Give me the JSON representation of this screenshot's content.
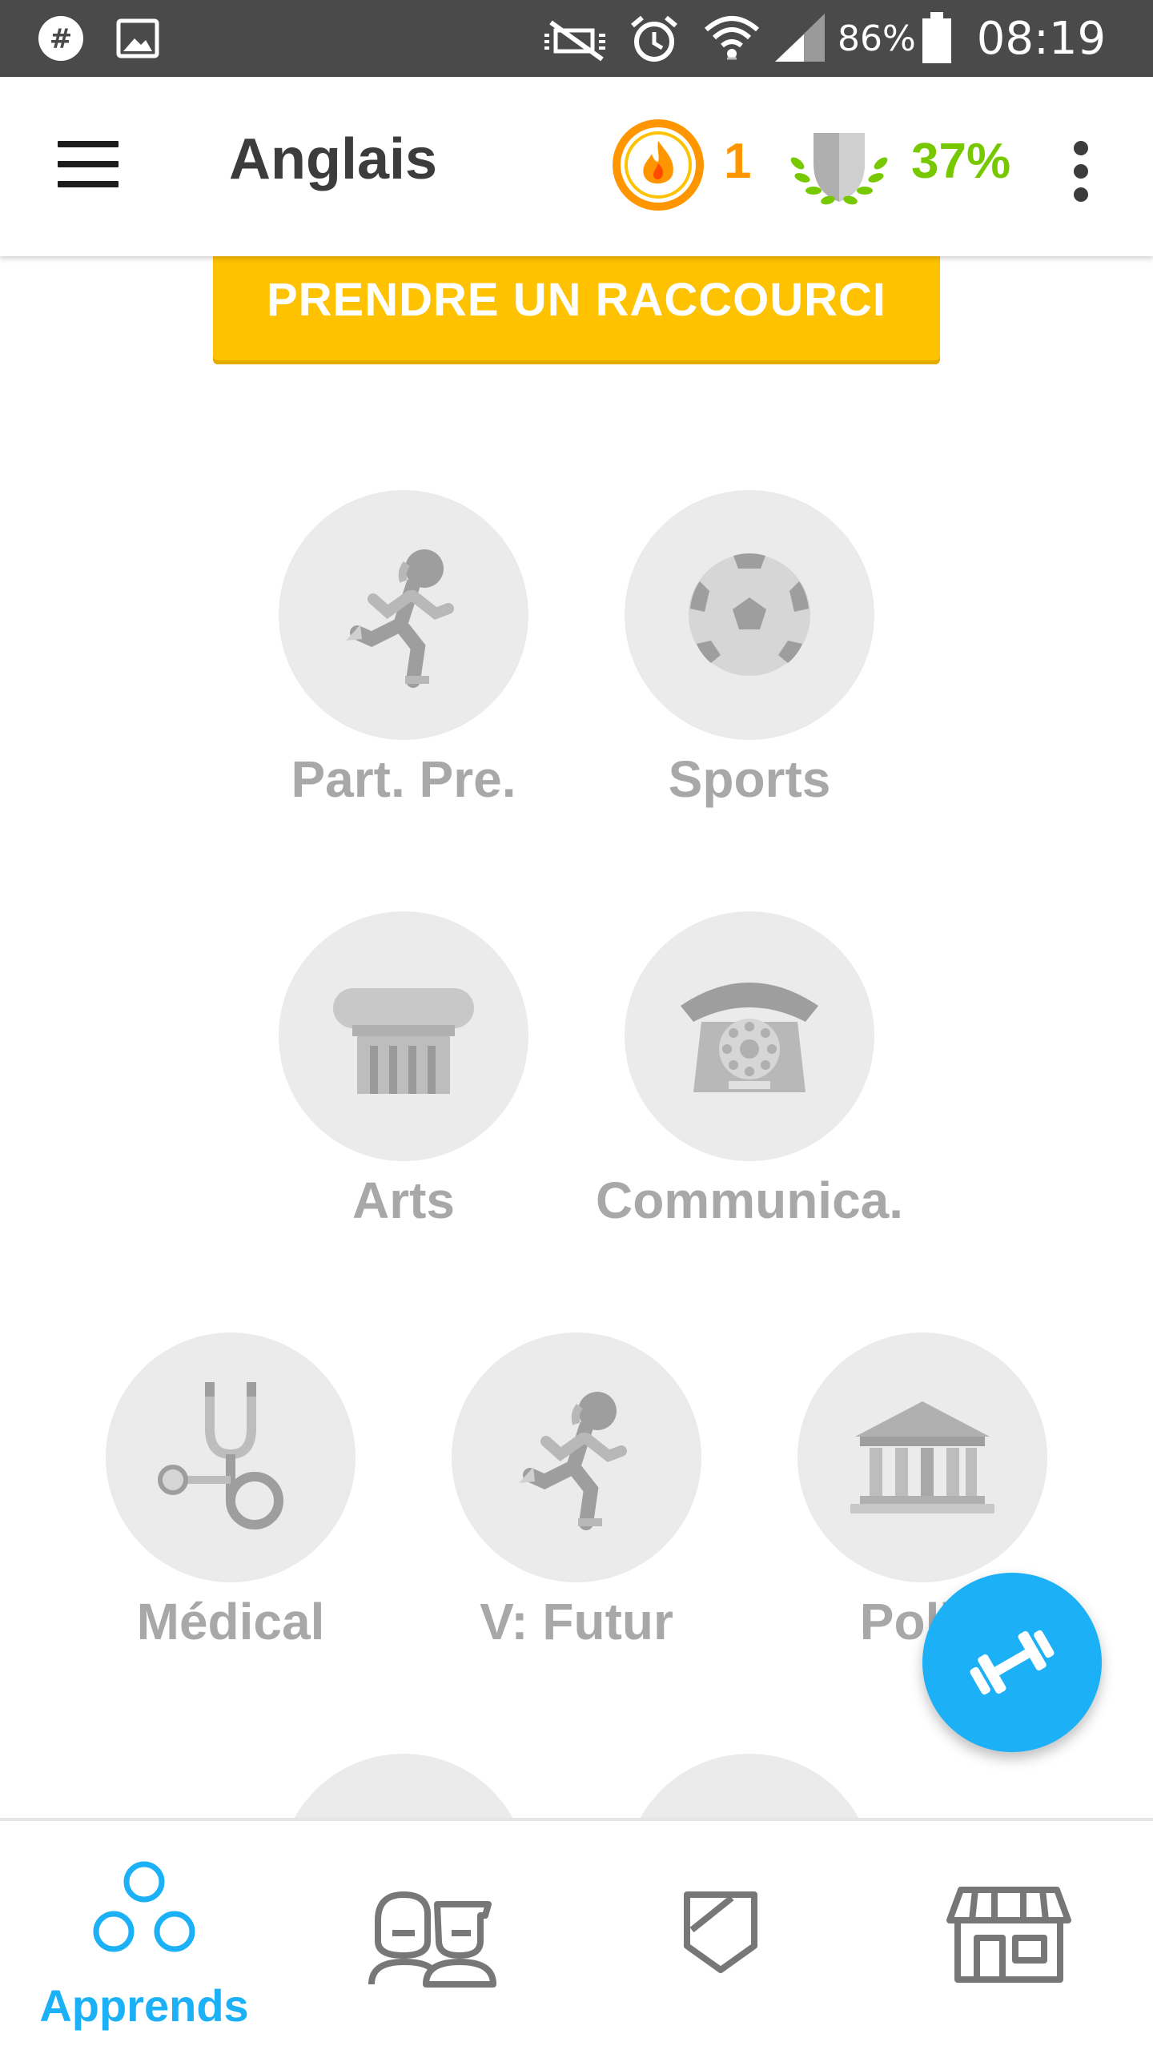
{
  "status_bar": {
    "battery": "86%",
    "time": "08:19",
    "icons": [
      "slack-icon",
      "gallery-icon",
      "mute-icon",
      "alarm-icon",
      "wifi-icon",
      "signal-icon",
      "battery-icon"
    ]
  },
  "app_bar": {
    "title": "Anglais",
    "streak": "1",
    "fluency": "37%",
    "colors": {
      "streak": "#ff9600",
      "fluency": "#78c800"
    }
  },
  "shortcut": {
    "label": "PRENDRE UN RACCOURCI",
    "color": "#ffc200"
  },
  "skills": [
    {
      "label": "Part. Pre.",
      "icon": "runner-icon"
    },
    {
      "label": "Sports",
      "icon": "soccer-ball-icon"
    },
    {
      "label": "Arts",
      "icon": "column-icon"
    },
    {
      "label": "Communica.",
      "icon": "telephone-icon"
    },
    {
      "label": "Médical",
      "icon": "stethoscope-icon"
    },
    {
      "label": "V: Futur",
      "icon": "runner-icon"
    },
    {
      "label": "Politi",
      "icon": "government-building-icon"
    }
  ],
  "fab": {
    "icon": "dumbbell-icon",
    "color": "#1cb0f6"
  },
  "bottom_nav": {
    "items": [
      {
        "label": "Apprends",
        "icon": "learn-icon",
        "active": true
      },
      {
        "label": "",
        "icon": "friends-icon",
        "active": false
      },
      {
        "label": "",
        "icon": "shield-icon",
        "active": false
      },
      {
        "label": "",
        "icon": "shop-icon",
        "active": false
      }
    ]
  }
}
